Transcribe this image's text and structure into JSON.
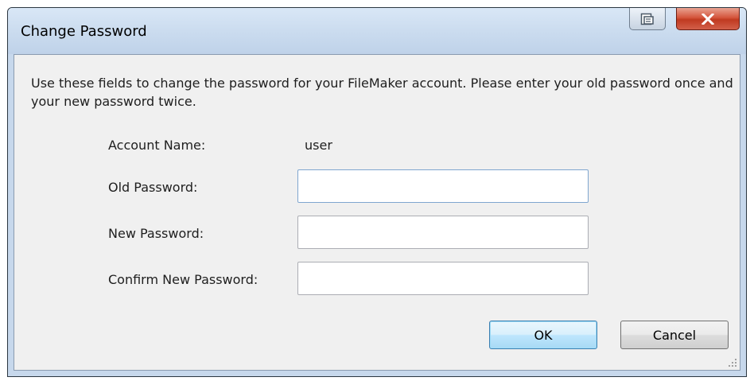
{
  "dialog": {
    "title": "Change Password",
    "description": "Use these fields to change the password for your FileMaker account. Please enter your old password once and your new password twice."
  },
  "titlebar": {
    "help_icon": "context-help-icon",
    "close_icon": "close-x-icon"
  },
  "form": {
    "account_name_label": "Account Name:",
    "account_name_value": "user",
    "old_password_label": "Old Password:",
    "old_password_value": "",
    "new_password_label": "New Password:",
    "new_password_value": "",
    "confirm_password_label": "Confirm New Password:",
    "confirm_password_value": ""
  },
  "buttons": {
    "ok_label": "OK",
    "cancel_label": "Cancel"
  },
  "colors": {
    "window_frame": "#c7d8ec",
    "dialog_background": "#f0f0f0",
    "close_button": "#c7402a",
    "default_button": "#bee6fd"
  }
}
